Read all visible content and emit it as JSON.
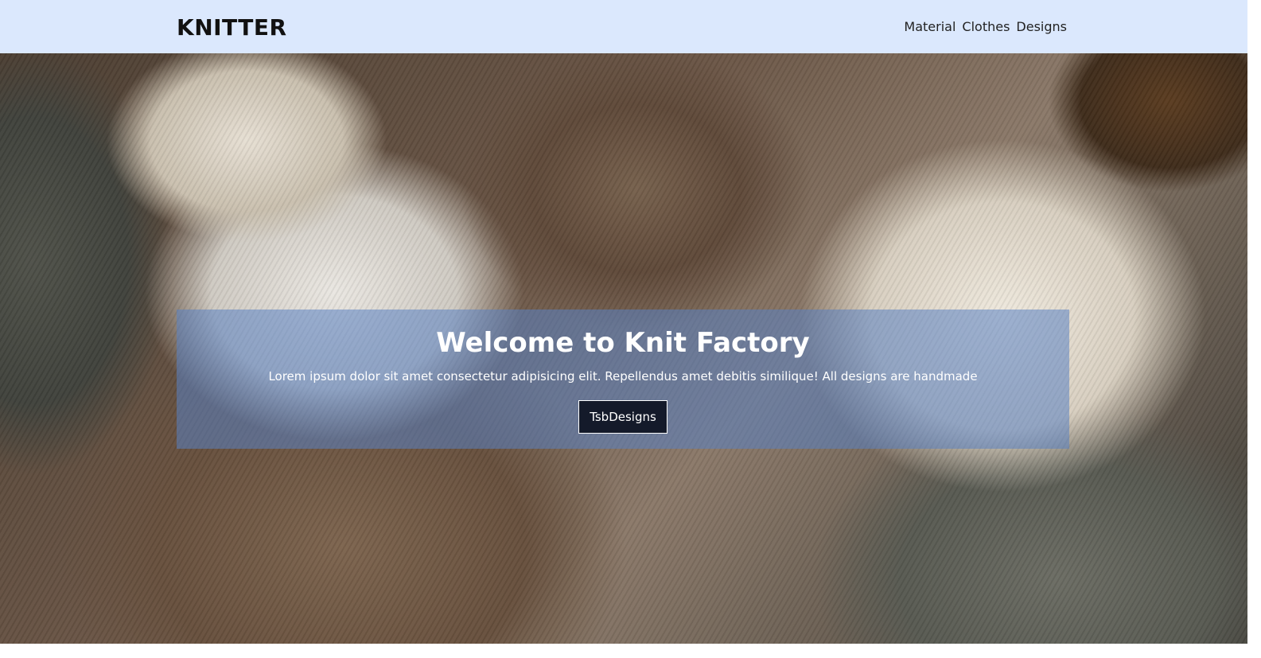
{
  "header": {
    "logo": "KNITTER",
    "nav": [
      "Material",
      "Clothes",
      "Designs"
    ]
  },
  "hero": {
    "title": "Welcome to Knit Factory",
    "text": "Lorem ipsum dolor sit amet consectetur adipisicing elit. Repellendus amet debitis similique! All designs are handmade",
    "button_label": "TsbDesigns"
  },
  "colors": {
    "header_bg": "#dbe8fd",
    "banner_bg": "rgba(90,130,195,0.55)",
    "button_bg": "#141a2a"
  }
}
